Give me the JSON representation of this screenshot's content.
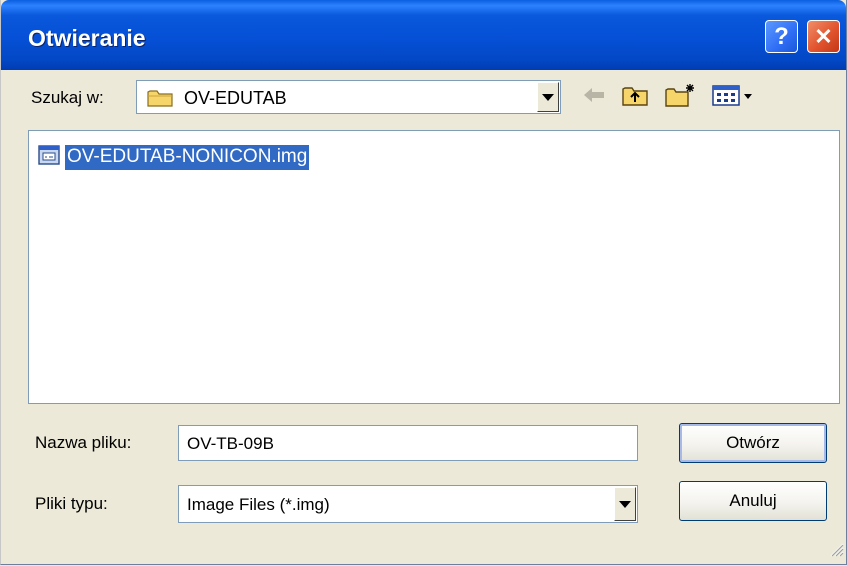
{
  "window": {
    "title": "Otwieranie",
    "help_glyph": "?",
    "close_glyph": "✕"
  },
  "look_in": {
    "label": "Szukaj w:",
    "value": "OV-EDUTAB",
    "icon": "folder-icon"
  },
  "toolbar": {
    "icons": [
      "back-arrow-icon",
      "up-folder-icon",
      "new-folder-icon",
      "view-menu-icon"
    ]
  },
  "file_list": {
    "items": [
      {
        "name": "OV-EDUTAB-NONICON.img",
        "icon": "image-file-icon",
        "selected": true
      }
    ]
  },
  "file_name": {
    "label": "Nazwa pliku:",
    "value": "OV-TB-09B"
  },
  "file_type": {
    "label": "Pliki typu:",
    "value": "Image Files (*.img)"
  },
  "buttons": {
    "open": "Otwórz",
    "cancel": "Anuluj"
  },
  "colors": {
    "titlebar": "#0550d6",
    "selection": "#316ac5",
    "face": "#ece9d8"
  }
}
